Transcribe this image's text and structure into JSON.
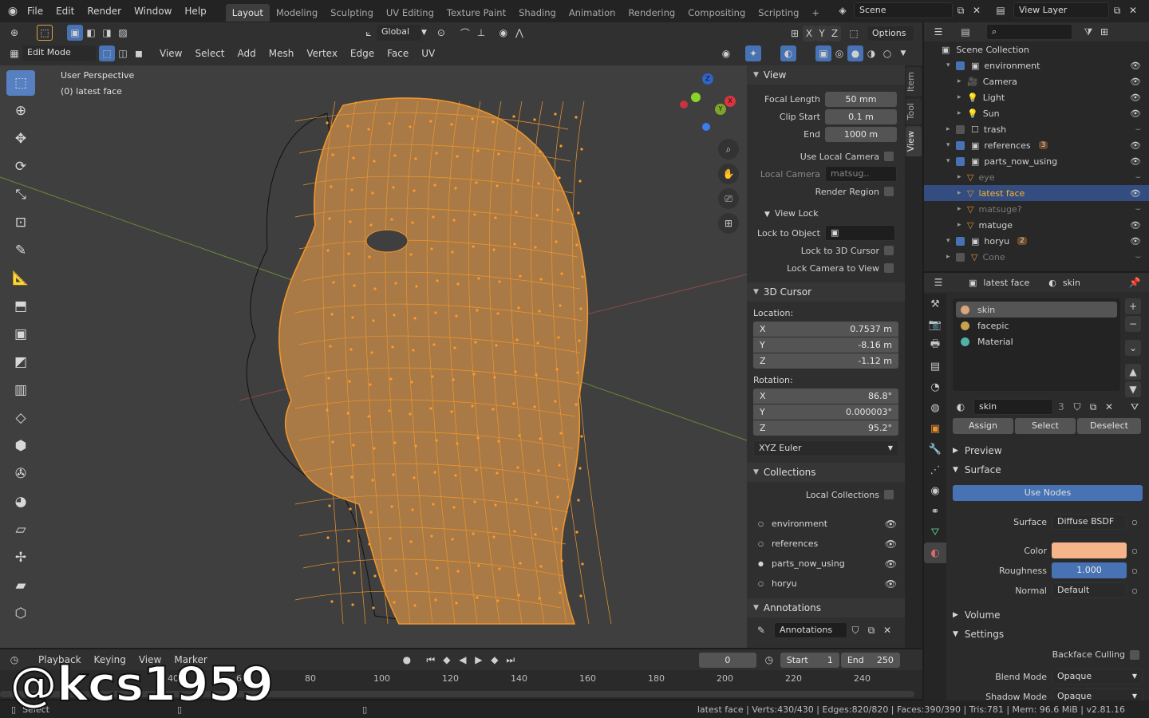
{
  "topbar": {
    "menus": [
      "File",
      "Edit",
      "Render",
      "Window",
      "Help"
    ],
    "workspaces": [
      "Layout",
      "Modeling",
      "Sculpting",
      "UV Editing",
      "Texture Paint",
      "Shading",
      "Animation",
      "Rendering",
      "Compositing",
      "Scripting"
    ],
    "active_workspace": "Layout",
    "scene": "Scene",
    "view_layer": "View Layer"
  },
  "viewport_header": {
    "transform_orientation": "Global",
    "options": "Options",
    "mode": "Edit Mode",
    "menus": [
      "View",
      "Select",
      "Add",
      "Mesh",
      "Vertex",
      "Edge",
      "Face",
      "UV"
    ]
  },
  "viewport": {
    "perspective": "User Perspective",
    "object_info": "(0) latest face",
    "gizmo_axes": {
      "x": "X",
      "y": "Y",
      "z": "Z"
    },
    "accent_color": "#e8912f"
  },
  "npanel": {
    "tabs": [
      "Item",
      "Tool",
      "View"
    ],
    "active_tab": "View",
    "view": {
      "title": "View",
      "focal_length_label": "Focal Length",
      "focal_length": "50 mm",
      "clip_start_label": "Clip Start",
      "clip_start": "0.1 m",
      "end_label": "End",
      "end": "1000 m",
      "use_local_camera": "Use Local Camera",
      "local_camera_label": "Local Camera",
      "local_camera": "matsug..",
      "render_region": "Render Region"
    },
    "view_lock": {
      "title": "View Lock",
      "lock_to_object": "Lock to Object",
      "lock_to_cursor": "Lock to 3D Cursor",
      "lock_camera": "Lock Camera to View"
    },
    "cursor": {
      "title": "3D Cursor",
      "location_label": "Location:",
      "loc": [
        {
          "axis": "X",
          "value": "0.7537 m"
        },
        {
          "axis": "Y",
          "value": "-8.16 m"
        },
        {
          "axis": "Z",
          "value": "-1.12 m"
        }
      ],
      "rotation_label": "Rotation:",
      "rot": [
        {
          "axis": "X",
          "value": "86.8°"
        },
        {
          "axis": "Y",
          "value": "0.000003°"
        },
        {
          "axis": "Z",
          "value": "95.2°"
        }
      ],
      "rotation_mode": "XYZ Euler"
    },
    "collections": {
      "title": "Collections",
      "local": "Local Collections",
      "items": [
        "environment",
        "references",
        "parts_now_using",
        "horyu"
      ]
    },
    "annotations": {
      "title": "Annotations",
      "layer": "Annotations"
    }
  },
  "outliner": {
    "root": "Scene Collection",
    "rows": [
      {
        "name": "environment",
        "indent": 1,
        "kind": "collection",
        "visible": true
      },
      {
        "name": "Camera",
        "indent": 2,
        "kind": "camera",
        "visible": true
      },
      {
        "name": "Light",
        "indent": 2,
        "kind": "light",
        "visible": true
      },
      {
        "name": "Sun",
        "indent": 2,
        "kind": "light",
        "visible": true
      },
      {
        "name": "trash",
        "indent": 1,
        "kind": "collection-off",
        "visible": false
      },
      {
        "name": "references",
        "indent": 1,
        "kind": "collection",
        "visible": true,
        "badge": "3"
      },
      {
        "name": "parts_now_using",
        "indent": 1,
        "kind": "collection",
        "visible": true
      },
      {
        "name": "eye",
        "indent": 2,
        "kind": "mesh",
        "visible": false,
        "dim": true
      },
      {
        "name": "latest face",
        "indent": 2,
        "kind": "mesh",
        "visible": true,
        "selected": true
      },
      {
        "name": "matsuge?",
        "indent": 2,
        "kind": "mesh",
        "visible": false,
        "dim": true
      },
      {
        "name": "matuge",
        "indent": 2,
        "kind": "mesh",
        "visible": true
      },
      {
        "name": "horyu",
        "indent": 1,
        "kind": "collection",
        "visible": true,
        "badge": "2"
      },
      {
        "name": "Cone",
        "indent": 1,
        "kind": "mesh",
        "visible": false,
        "dim": true
      }
    ]
  },
  "properties": {
    "object": "latest face",
    "material_crumb": "skin",
    "slots": [
      "skin",
      "facepic",
      "Material"
    ],
    "slot_colors": [
      "#d9a57a",
      "#c9a14d",
      "#4fb3a6"
    ],
    "material_name": "skin",
    "users": "3",
    "assign": "Assign",
    "select": "Select",
    "deselect": "Deselect",
    "preview": "Preview",
    "surface_title": "Surface",
    "use_nodes": "Use Nodes",
    "surface_label": "Surface",
    "surface_value": "Diffuse BSDF",
    "color_label": "Color",
    "color_value": "#f5b48a",
    "roughness_label": "Roughness",
    "roughness_value": "1.000",
    "roughness": 1.0,
    "normal_label": "Normal",
    "normal_value": "Default",
    "volume": "Volume",
    "settings": "Settings",
    "backface": "Backface Culling",
    "blend_label": "Blend Mode",
    "blend_value": "Opaque",
    "shadow_label": "Shadow Mode",
    "shadow_value": "Opaque"
  },
  "timeline": {
    "menus": [
      "Playback",
      "Keying",
      "View",
      "Marker"
    ],
    "current_frame": "0",
    "start_label": "Start",
    "start": "1",
    "end_label": "End",
    "end": "250",
    "ticks": [
      "40",
      "60",
      "80",
      "100",
      "120",
      "140",
      "160",
      "180",
      "200",
      "220",
      "240"
    ]
  },
  "statusbar": {
    "select": "Select",
    "stats": "latest face | Verts:430/430 | Edges:820/820 | Faces:390/390 | Tris:781 | Mem: 96.6 MiB | v2.81.16"
  },
  "watermark": "@kcs1959"
}
